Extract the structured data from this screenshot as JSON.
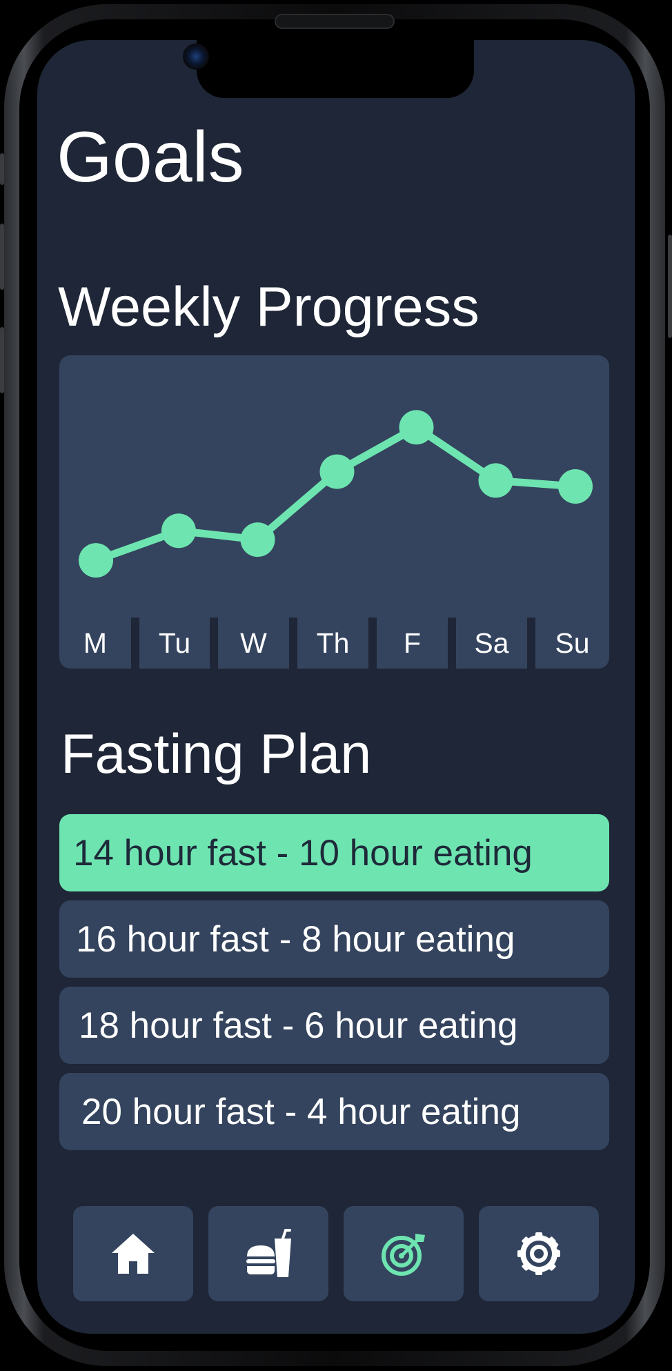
{
  "screen": {
    "title": "Goals"
  },
  "weekly_progress": {
    "title": "Weekly Progress",
    "days": [
      "M",
      "Tu",
      "W",
      "Th",
      "F",
      "Sa",
      "Su"
    ],
    "line_color": "#6ee5b0",
    "card_color": "#34445e"
  },
  "chart_data": {
    "type": "line",
    "categories": [
      "M",
      "Tu",
      "W",
      "Th",
      "F",
      "Sa",
      "Su"
    ],
    "values": [
      1.0,
      2.0,
      1.7,
      4.0,
      5.5,
      3.7,
      3.5
    ],
    "ylim": [
      0,
      7
    ],
    "grid": false,
    "legend": "none"
  },
  "fasting_plan": {
    "title": "Fasting Plan",
    "options": [
      {
        "label": "14 hour fast - 10 hour eating",
        "selected": true
      },
      {
        "label": "16 hour fast - 8 hour eating",
        "selected": false
      },
      {
        "label": "18 hour fast - 6 hour eating",
        "selected": false
      },
      {
        "label": "20 hour fast - 4 hour eating",
        "selected": false
      }
    ],
    "selected_color": "#6ee5b0"
  },
  "tab_bar": {
    "tabs": [
      {
        "icon": "home-icon",
        "active": false
      },
      {
        "icon": "food-icon",
        "active": false
      },
      {
        "icon": "target-icon",
        "active": true
      },
      {
        "icon": "gear-icon",
        "active": false
      }
    ],
    "active_color": "#6ee5b0",
    "inactive_color": "#ffffff"
  },
  "colors": {
    "background": "#1e2637",
    "card": "#34445e",
    "accent": "#6ee5b0",
    "text": "#ffffff"
  }
}
